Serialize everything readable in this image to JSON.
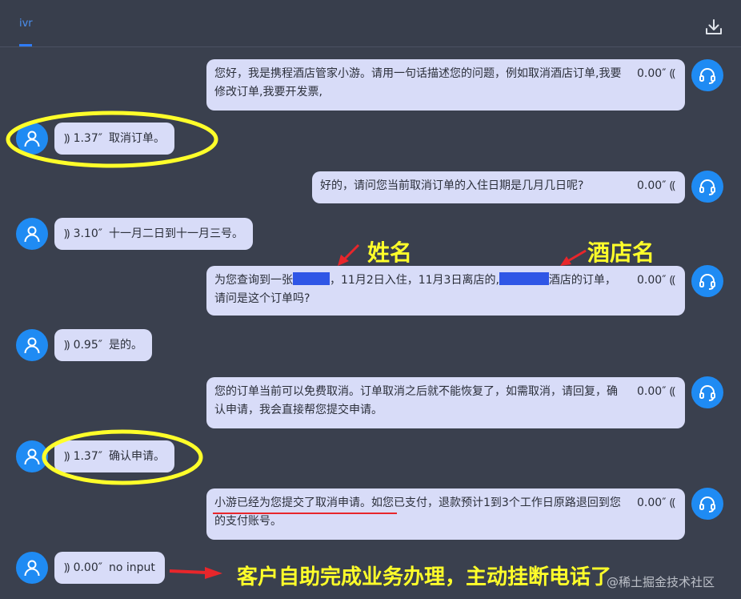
{
  "header": {
    "tab_label": "ivr",
    "download_icon": "download-icon"
  },
  "messages": [
    {
      "role": "bot",
      "text": "您好，我是携程酒店管家小游。请用一句话描述您的问题，例如取消酒店订单,我要修改订单,我要开发票,",
      "duration": "0.00″"
    },
    {
      "role": "user",
      "text": "取消订单。",
      "duration": "1.37″"
    },
    {
      "role": "bot",
      "text": "好的，请问您当前取消订单的入住日期是几月几日呢?",
      "duration": "0.00″"
    },
    {
      "role": "user",
      "text": "十一月二日到十一月三号。",
      "duration": "3.10″"
    },
    {
      "role": "bot",
      "text_parts": [
        "为您查询到一张",
        "，11月2日入住，11月3日离店的,",
        "酒店的",
        "订单，请问是这个订单吗?"
      ],
      "duration": "0.00″"
    },
    {
      "role": "user",
      "text": "是的。",
      "duration": "0.95″"
    },
    {
      "role": "bot",
      "text": "您的订单当前可以免费取消。订单取消之后就不能恢复了，如需取消，请回复，确认申请，我会直接帮您提交申请。",
      "duration": "0.00″"
    },
    {
      "role": "user",
      "text": "确认申请。",
      "duration": "1.37″"
    },
    {
      "role": "bot",
      "text_parts": [
        "小游已经为您提交了取消申请。",
        "如您已支付，退款预计1到3个工作日原路退回到您的支付账号。"
      ],
      "duration": "0.00″"
    },
    {
      "role": "user",
      "text": "no input",
      "duration": "0.00″"
    }
  ],
  "annotations": {
    "name_label": "姓名",
    "hotel_label": "酒店名",
    "summary": "客户自助完成业务办理，主动挂断电话了",
    "highlight_color": "#ffff2a",
    "arrow_color": "#e8262b",
    "mask_color": "#2f56e6"
  },
  "watermark": "@稀土掘金技术社区",
  "colors": {
    "background": "#3a404e",
    "bubble": "#d8dcf8",
    "avatar": "#1f8bf3",
    "tab": "#4a8ff0"
  }
}
